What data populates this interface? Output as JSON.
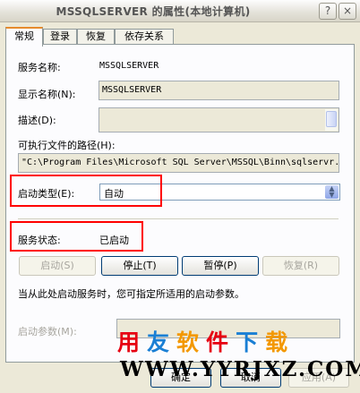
{
  "window": {
    "title": "MSSQLSERVER 的属性(本地计算机)"
  },
  "titlebar": {
    "help_glyph": "?",
    "close_glyph": "×"
  },
  "tabs": [
    {
      "label": "常规",
      "active": true
    },
    {
      "label": "登录",
      "active": false
    },
    {
      "label": "恢复",
      "active": false
    },
    {
      "label": "依存关系",
      "active": false
    }
  ],
  "general": {
    "service_name_label": "服务名称:",
    "service_name_value": "MSSQLSERVER",
    "display_name_label": "显示名称(N):",
    "display_name_value": "MSSQLSERVER",
    "description_label": "描述(D):",
    "description_value": "",
    "path_label": "可执行文件的路径(H):",
    "path_value": "\"C:\\Program Files\\Microsoft SQL Server\\MSSQL\\Binn\\sqlservr.",
    "startup_type_label": "启动类型(E):",
    "startup_type_value": "自动",
    "status_label": "服务状态:",
    "status_value": "已启动",
    "buttons": {
      "start": "启动(S)",
      "stop": "停止(T)",
      "pause": "暂停(P)",
      "resume": "恢复(R)"
    },
    "hint": "当从此处启动服务时，您可指定所适用的启动参数。",
    "start_params_label": "启动参数(M):",
    "start_params_value": ""
  },
  "footer": {
    "ok": "确定",
    "cancel": "取消",
    "apply": "应用(A)"
  },
  "watermark": {
    "cn_text": "用友软件下载",
    "url_text": "WWW.YYRJXZ.COM",
    "colors": [
      "#e60012",
      "#1a7fd4",
      "#f39800",
      "#e60012",
      "#1a7fd4",
      "#f39800"
    ]
  },
  "highlight_color": "#ff0000"
}
